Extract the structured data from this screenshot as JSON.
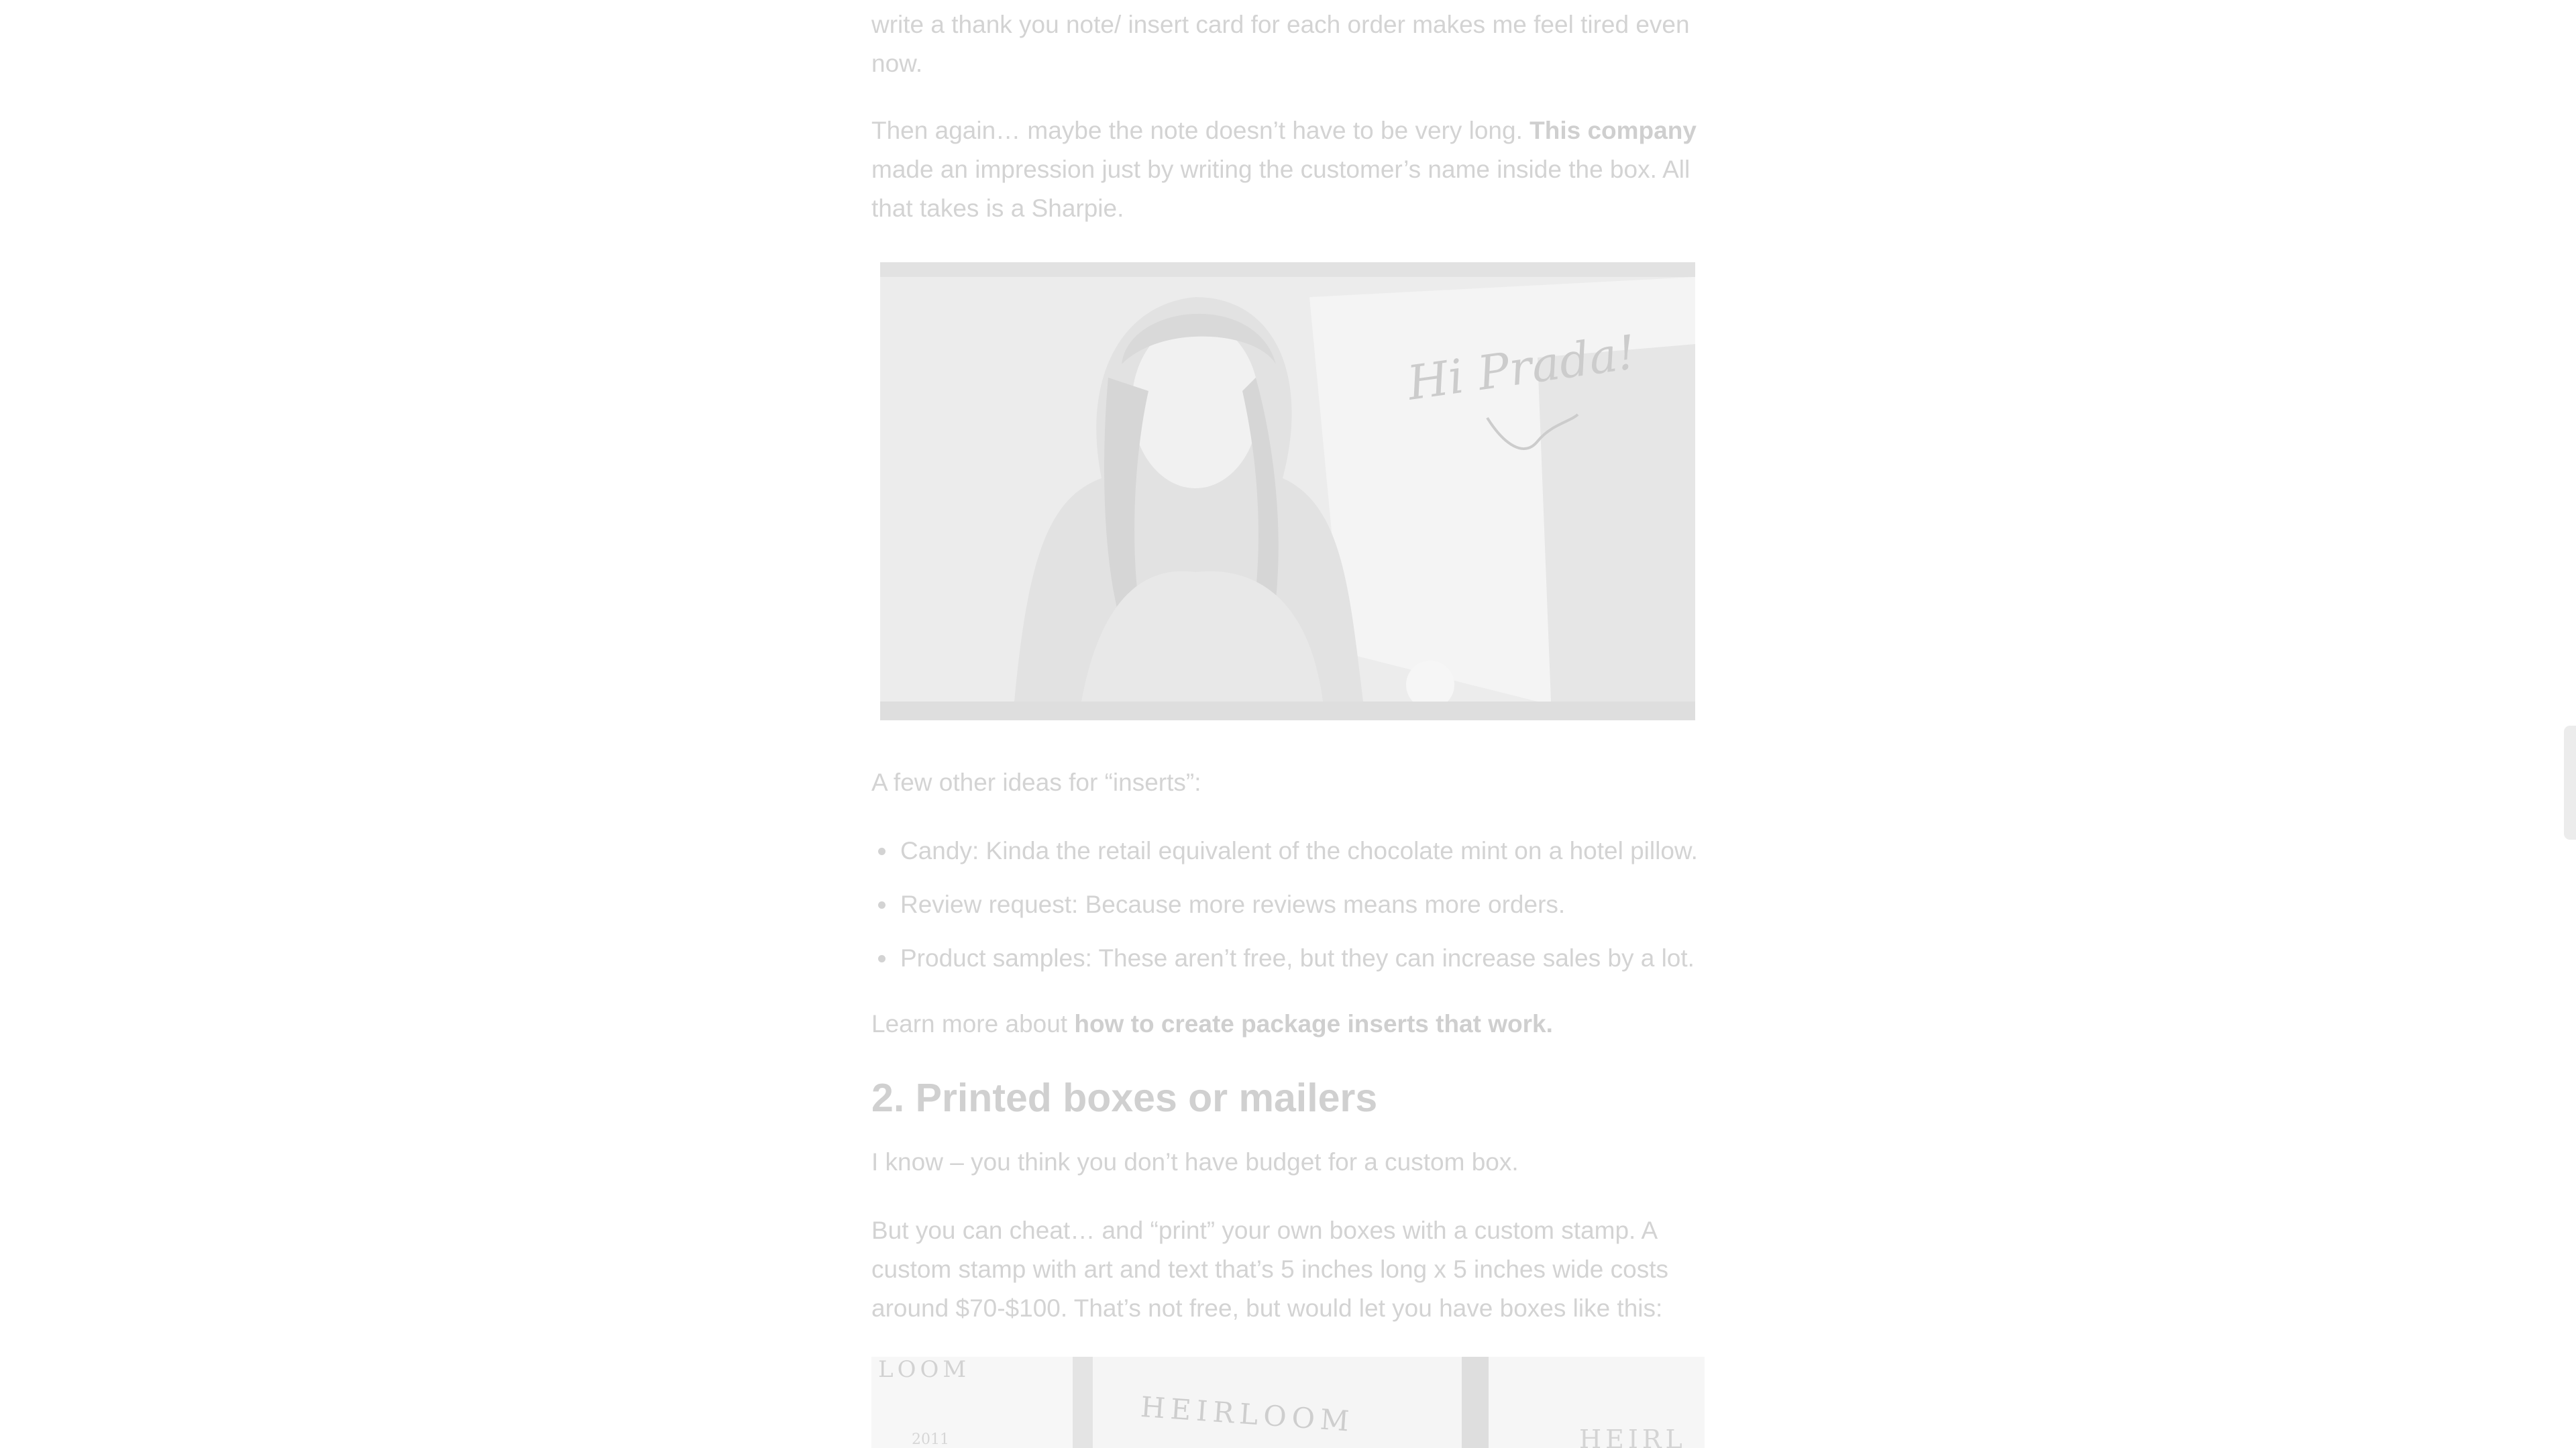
{
  "article": {
    "para_top": "write a thank you note/ insert card for each order makes me feel tired even now.",
    "para_note_prefix": "Then again… maybe the note doesn’t have to be very long. ",
    "para_note_link": "This company",
    "para_note_suffix": " made an impression just by writing the customer’s name inside the box. All that takes is a Sharpie.",
    "video_handwriting": "Hi Prada!",
    "inserts_intro": "A few other ideas for “inserts”:",
    "bullets": [
      "Candy: Kinda the retail equivalent of the chocolate mint on a hotel pillow.",
      "Review request: Because more reviews means more orders.",
      "Product samples: These aren’t free, but they can increase sales by a lot."
    ],
    "learn_more_prefix": "Learn more about ",
    "learn_more_link": "how to create package inserts that work.",
    "heading_2": "2. Printed boxes or mailers",
    "para_budget": "I know – you think you don’t have budget for a custom box.",
    "para_cheat": "But you can cheat… and “print” your own boxes with a custom stamp. A custom stamp with art and text that’s 5 inches long x 5 inches wide costs around $70-$100. That’s not free, but would let you have boxes like this:",
    "photo_text_1": "HEIRLOOM",
    "photo_text_2": "LOOM",
    "photo_text_3": "2011",
    "photo_text_4": "HEIRL"
  },
  "colors": {
    "text": "#d3d3d3",
    "background": "#ffffff",
    "link": "#cfcfcf"
  }
}
